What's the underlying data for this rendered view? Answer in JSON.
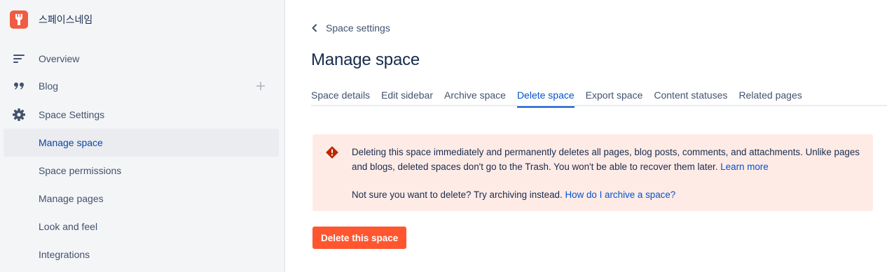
{
  "sidebar": {
    "space_name": "스페이스네임",
    "logo_icon": "space-logo-icon",
    "nav": [
      {
        "label": "Overview",
        "icon": "overview-icon"
      },
      {
        "label": "Blog",
        "icon": "quote-icon"
      },
      {
        "label": "Space Settings",
        "icon": "gear-icon"
      }
    ],
    "settings_items": [
      {
        "label": "Manage space",
        "selected": true
      },
      {
        "label": "Space permissions"
      },
      {
        "label": "Manage pages"
      },
      {
        "label": "Look and feel"
      },
      {
        "label": "Integrations"
      }
    ]
  },
  "main": {
    "breadcrumb": "Space settings",
    "title": "Manage space",
    "tabs": [
      {
        "label": "Space details"
      },
      {
        "label": "Edit sidebar"
      },
      {
        "label": "Archive space"
      },
      {
        "label": "Delete space",
        "active": true
      },
      {
        "label": "Export space"
      },
      {
        "label": "Content statuses"
      },
      {
        "label": "Related pages"
      }
    ],
    "warning": {
      "icon": "error-icon",
      "text1": "Deleting this space immediately and permanently deletes all pages, blog posts, comments, and attachments. Unlike pages and blogs, deleted spaces don't go to the Trash. You won't be able to recover them later.",
      "link1": "Learn more",
      "text2": "Not sure you want to delete? Try archiving instead.",
      "link2": "How do I archive a space?"
    },
    "delete_button": "Delete this space"
  },
  "colors": {
    "accent": "#0052cc",
    "danger": "#ff5630",
    "warning_bg": "#ffebe6",
    "logo": "#f15b43"
  }
}
